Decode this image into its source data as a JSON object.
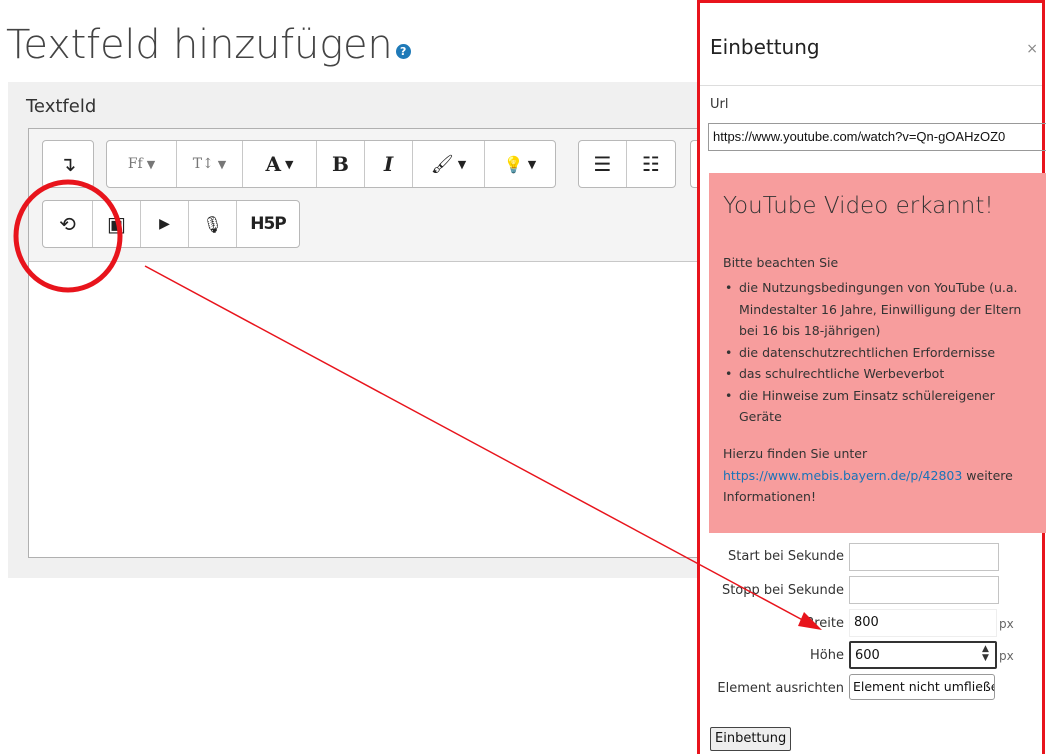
{
  "page": {
    "title": "Textfeld hinzufügen",
    "help_icon": "question-circle-icon"
  },
  "editor": {
    "field_label": "Textfeld",
    "toolbar_row1": [
      {
        "icon": "collapse-icon",
        "text": "↴"
      },
      {
        "icon": "font-family-icon",
        "text": "Ff"
      },
      {
        "icon": "font-size-icon",
        "text": "T↕"
      },
      {
        "icon": "font-color-icon",
        "text": "A"
      },
      {
        "icon": "bold-icon",
        "text": "B"
      },
      {
        "icon": "italic-icon",
        "text": "I"
      },
      {
        "icon": "brush-icon",
        "text": "🖌"
      },
      {
        "icon": "lightbulb-icon",
        "text": "💡"
      },
      {
        "icon": "unordered-list-icon",
        "text": "☰"
      },
      {
        "icon": "ordered-list-icon",
        "text": "☷"
      }
    ],
    "toolbar_row2": [
      {
        "icon": "embed-icon",
        "text": "⟲"
      },
      {
        "icon": "image-icon",
        "text": "▣"
      },
      {
        "icon": "video-icon",
        "text": "▶"
      },
      {
        "icon": "microphone-icon",
        "text": "🎙"
      },
      {
        "icon": "h5p-icon",
        "text": "H5P"
      }
    ]
  },
  "dialog": {
    "title": "Einbettung",
    "close": "×",
    "url_label": "Url",
    "url_value": "https://www.youtube.com/watch?v=Qn-gOAHzOZ0",
    "alert": {
      "title": "YouTube Video erkannt!",
      "note": "Bitte beachten Sie",
      "items": [
        "die Nutzungsbedingungen von YouTube (u.a. Mindestalter 16 Jahre, Einwilligung der Eltern bei 16 bis 18-jährigen)",
        "die datenschutzrechtlichen Erfordernisse",
        "das schulrechtliche Werbeverbot",
        "die Hinweise zum Einsatz schülereigener Geräte"
      ],
      "info_before": "Hierzu finden Sie unter ",
      "info_link": "https://www.mebis.bayern.de/p/42803",
      "info_after": " weitere Informationen!"
    },
    "fields": {
      "start_label": "Start bei Sekunde",
      "start_value": "",
      "stop_label": "Stopp bei Sekunde",
      "stop_value": "",
      "width_label": "Breite",
      "width_value": "800",
      "height_label": "Höhe",
      "height_value": "600",
      "unit": "px",
      "align_label": "Element ausrichten",
      "align_value": "Element nicht umfließen"
    },
    "submit_label": "Einbettung"
  },
  "colors": {
    "annotation": "#e8141c",
    "alert_bg": "#f79d9d",
    "link": "#1a73b8"
  }
}
